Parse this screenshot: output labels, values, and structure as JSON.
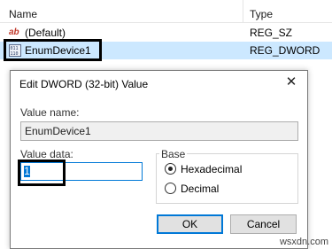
{
  "registry": {
    "header": {
      "name": "Name",
      "type": "Type"
    },
    "rows": [
      {
        "icon": "string-value-icon",
        "glyph": "ab",
        "name": "(Default)",
        "type": "REG_SZ"
      },
      {
        "icon": "binary-value-icon",
        "glyph": "011\n110",
        "name": "EnumDevice1",
        "type": "REG_DWORD"
      }
    ]
  },
  "dialog": {
    "title": "Edit DWORD (32-bit) Value",
    "value_name_label": "Value name:",
    "value_name": "EnumDevice1",
    "value_data_label": "Value data:",
    "value_data": "1",
    "base_label": "Base",
    "base_options": [
      "Hexadecimal",
      "Decimal"
    ],
    "base_selected": "Hexadecimal",
    "ok_label": "OK",
    "cancel_label": "Cancel",
    "close_glyph": "✕"
  },
  "watermark": "wsxdn.com",
  "colors": {
    "selection": "#cce8ff",
    "accent": "#0078d7"
  }
}
